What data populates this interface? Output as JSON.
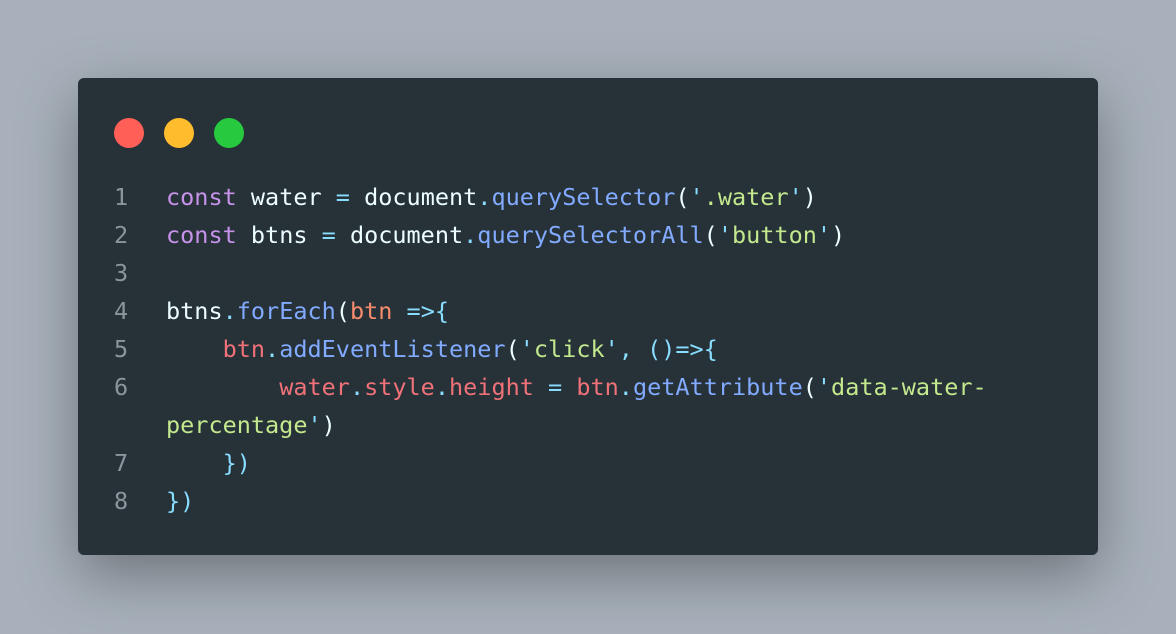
{
  "window": {
    "buttons": [
      {
        "name": "close",
        "color": "#ff5f56"
      },
      {
        "name": "minimize",
        "color": "#ffbd2e"
      },
      {
        "name": "zoom",
        "color": "#27c93f"
      }
    ]
  },
  "code": {
    "line_numbers": [
      "1",
      "2",
      "3",
      "4",
      "5",
      "6",
      "7",
      "8"
    ],
    "lines": [
      [
        {
          "t": "const",
          "c": "kw"
        },
        {
          "t": " water ",
          "c": "plain"
        },
        {
          "t": "=",
          "c": "pun"
        },
        {
          "t": " document",
          "c": "plain"
        },
        {
          "t": ".",
          "c": "pun"
        },
        {
          "t": "querySelector",
          "c": "fn"
        },
        {
          "t": "(",
          "c": "plain"
        },
        {
          "t": "'",
          "c": "pun"
        },
        {
          "t": ".water",
          "c": "str"
        },
        {
          "t": "'",
          "c": "pun"
        },
        {
          "t": ")",
          "c": "plain"
        }
      ],
      [
        {
          "t": "const",
          "c": "kw"
        },
        {
          "t": " btns ",
          "c": "plain"
        },
        {
          "t": "=",
          "c": "pun"
        },
        {
          "t": " document",
          "c": "plain"
        },
        {
          "t": ".",
          "c": "pun"
        },
        {
          "t": "querySelectorAll",
          "c": "fn"
        },
        {
          "t": "(",
          "c": "plain"
        },
        {
          "t": "'",
          "c": "pun"
        },
        {
          "t": "button",
          "c": "str"
        },
        {
          "t": "'",
          "c": "pun"
        },
        {
          "t": ")",
          "c": "plain"
        }
      ],
      [],
      [
        {
          "t": "btns",
          "c": "plain"
        },
        {
          "t": ".",
          "c": "pun"
        },
        {
          "t": "forEach",
          "c": "fn"
        },
        {
          "t": "(",
          "c": "plain"
        },
        {
          "t": "btn",
          "c": "par"
        },
        {
          "t": " =>{",
          "c": "pun"
        }
      ],
      [
        {
          "t": "    ",
          "c": "plain"
        },
        {
          "t": "btn",
          "c": "var"
        },
        {
          "t": ".",
          "c": "pun"
        },
        {
          "t": "addEventListener",
          "c": "fn"
        },
        {
          "t": "(",
          "c": "plain"
        },
        {
          "t": "'",
          "c": "pun"
        },
        {
          "t": "click",
          "c": "str"
        },
        {
          "t": "'",
          "c": "pun"
        },
        {
          "t": ", ",
          "c": "pun"
        },
        {
          "t": "()=>{",
          "c": "pun"
        }
      ],
      [
        {
          "t": "        ",
          "c": "plain"
        },
        {
          "t": "water",
          "c": "var"
        },
        {
          "t": ".",
          "c": "pun"
        },
        {
          "t": "style",
          "c": "var"
        },
        {
          "t": ".",
          "c": "pun"
        },
        {
          "t": "height",
          "c": "var"
        },
        {
          "t": " = ",
          "c": "pun"
        },
        {
          "t": "btn",
          "c": "var"
        },
        {
          "t": ".",
          "c": "pun"
        },
        {
          "t": "getAttribute",
          "c": "fn"
        },
        {
          "t": "(",
          "c": "plain"
        },
        {
          "t": "'",
          "c": "pun"
        },
        {
          "t": "data-water-",
          "c": "str"
        },
        {
          "t": "\n",
          "c": "plain"
        },
        {
          "t": "percentage",
          "c": "str"
        },
        {
          "t": "'",
          "c": "pun"
        },
        {
          "t": ")",
          "c": "plain"
        }
      ],
      [
        {
          "t": "    ",
          "c": "plain"
        },
        {
          "t": "})",
          "c": "pun"
        }
      ],
      [
        {
          "t": "})",
          "c": "pun"
        }
      ]
    ]
  }
}
